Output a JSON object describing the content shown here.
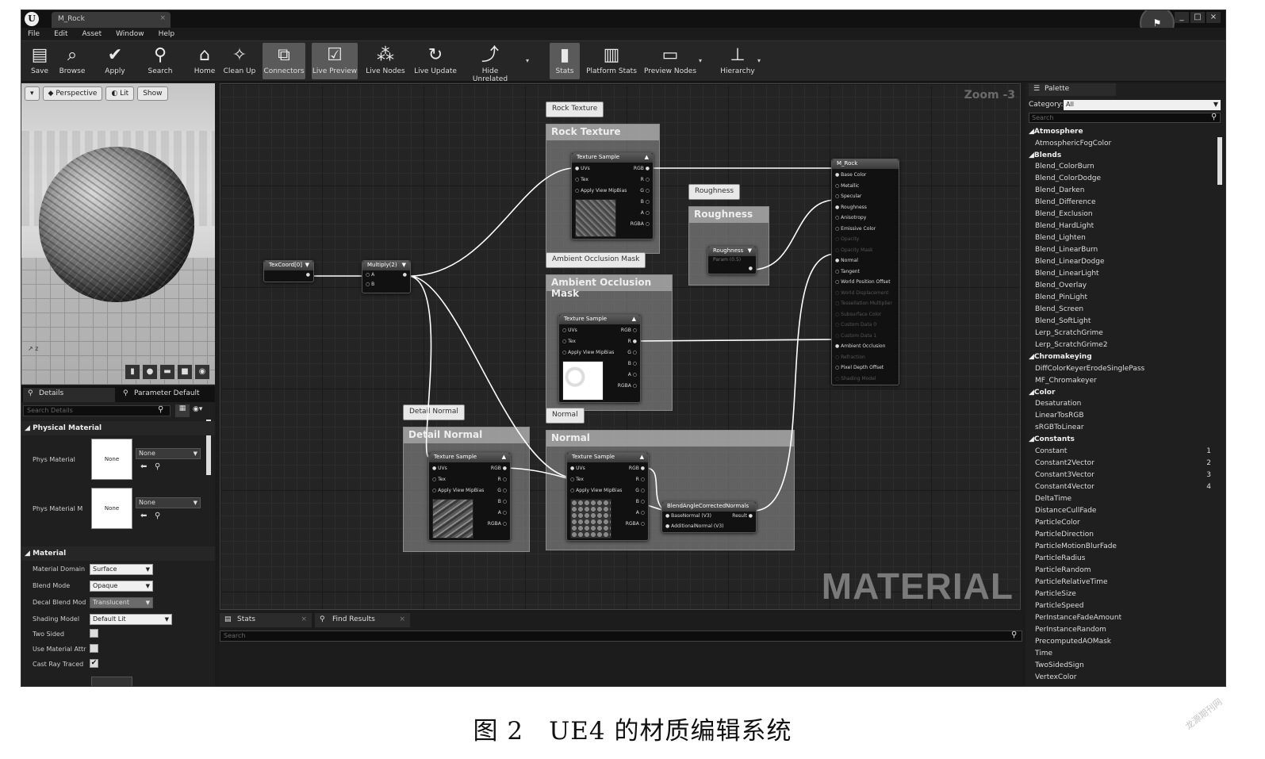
{
  "window": {
    "tab_title": "M_Rock",
    "controls": [
      "_",
      "□",
      "×"
    ],
    "feedback_icon": "flag-icon"
  },
  "menu": [
    "File",
    "Edit",
    "Asset",
    "Window",
    "Help"
  ],
  "toolbar": [
    {
      "label": "Save",
      "icon": "save-icon",
      "glyph": "▤"
    },
    {
      "label": "Browse",
      "icon": "browse-icon",
      "glyph": "⌕"
    },
    {
      "label": "Apply",
      "icon": "apply-icon",
      "glyph": "✔"
    },
    {
      "label": "Search",
      "icon": "search-icon",
      "glyph": "⚲"
    },
    {
      "label": "Home",
      "icon": "home-icon",
      "glyph": "⌂"
    },
    {
      "label": "Clean Up",
      "icon": "cleanup-icon",
      "glyph": "✧"
    },
    {
      "label": "Connectors",
      "icon": "connectors-icon",
      "glyph": "⧉"
    },
    {
      "label": "Live Preview",
      "icon": "live-preview-icon",
      "glyph": "☑"
    },
    {
      "label": "Live Nodes",
      "icon": "live-nodes-icon",
      "glyph": "⁂"
    },
    {
      "label": "Live Update",
      "icon": "live-update-icon",
      "glyph": "↻"
    },
    {
      "label": "Hide Unrelated",
      "icon": "hide-unrelated-icon",
      "glyph": "⤴"
    },
    {
      "label": "Stats",
      "icon": "stats-icon",
      "glyph": "▮"
    },
    {
      "label": "Platform Stats",
      "icon": "platform-stats-icon",
      "glyph": "▥"
    },
    {
      "label": "Preview Nodes",
      "icon": "preview-nodes-icon",
      "glyph": "▭"
    },
    {
      "label": "Hierarchy",
      "icon": "hierarchy-icon",
      "glyph": "⊥"
    }
  ],
  "viewport": {
    "menu_button": "▾",
    "perspective": "Perspective",
    "lit": "Lit",
    "show": "Show",
    "axis": "z",
    "preview_shapes": [
      "cylinder-icon",
      "sphere-icon",
      "plane-icon",
      "cube-icon",
      "teapot-icon"
    ]
  },
  "details": {
    "tab_details": "Details",
    "tab_param": "Parameter Default",
    "search_placeholder": "Search Details",
    "physical_material_header": "Physical Material",
    "phys_material_label": "Phys Material",
    "phys_material_mask_label": "Phys Material M",
    "thumb_text": "None",
    "combo_none": "None",
    "material_header": "Material",
    "rows": [
      {
        "label": "Material Domain",
        "value": "Surface"
      },
      {
        "label": "Blend Mode",
        "value": "Opaque"
      },
      {
        "label": "Decal Blend Mod",
        "value": "Translucent"
      },
      {
        "label": "Shading Model",
        "value": "Default Lit"
      }
    ],
    "two_sided": "Two Sided",
    "use_material": "Use Material Attr",
    "cast_ray": "Cast Ray Traced",
    "two_sided_checked": false,
    "use_material_checked": false,
    "cast_ray_checked": true
  },
  "graph": {
    "zoom": "Zoom -3",
    "watermark": "MATERIAL",
    "comments": {
      "rock": "Rock Texture",
      "roughness": "Roughness",
      "ao": "Ambient Occlusion Mask",
      "detail": "Detail Normal",
      "normal": "Normal"
    },
    "nodes": {
      "texcoord": "TexCoord[0]",
      "multiply": "Multiply(2)",
      "multiply_pins": [
        "A",
        "B"
      ],
      "texture_sample": "Texture Sample",
      "ts_inputs": [
        "UVs",
        "Tex",
        "Apply View MipBias"
      ],
      "ts_outputs": [
        "RGB",
        "R",
        "G",
        "B",
        "A",
        "RGBA"
      ],
      "roughness_param": "Roughness",
      "roughness_param_sub": "Param (0.5)",
      "blend": "BlendAngleCorrectedNormals",
      "blend_inputs": [
        "BaseNormal (V3)",
        "AdditionalNormal (V3)"
      ],
      "blend_output": "Result",
      "result": "M_Rock",
      "result_pins": [
        "Base Color",
        "Metallic",
        "Specular",
        "Roughness",
        "Anisotropy",
        "Emissive Color",
        "Opacity",
        "Opacity Mask",
        "Normal",
        "Tangent",
        "World Position Offset",
        "World Displacement",
        "Tessellation Multiplier",
        "Subsurface Color",
        "Custom Data 0",
        "Custom Data 1",
        "Ambient Occlusion",
        "Refraction",
        "Pixel Depth Offset",
        "Shading Model"
      ]
    }
  },
  "palette": {
    "tab": "Palette",
    "category_label": "Category:",
    "category_value": "All",
    "search_placeholder": "Search",
    "items": [
      {
        "text": "Atmosphere",
        "cat": true
      },
      {
        "text": "AtmosphericFogColor"
      },
      {
        "text": "Blends",
        "cat": true
      },
      {
        "text": "Blend_ColorBurn"
      },
      {
        "text": "Blend_ColorDodge"
      },
      {
        "text": "Blend_Darken"
      },
      {
        "text": "Blend_Difference"
      },
      {
        "text": "Blend_Exclusion"
      },
      {
        "text": "Blend_HardLight"
      },
      {
        "text": "Blend_Lighten"
      },
      {
        "text": "Blend_LinearBurn"
      },
      {
        "text": "Blend_LinearDodge"
      },
      {
        "text": "Blend_LinearLight"
      },
      {
        "text": "Blend_Overlay"
      },
      {
        "text": "Blend_PinLight"
      },
      {
        "text": "Blend_Screen"
      },
      {
        "text": "Blend_SoftLight"
      },
      {
        "text": "Lerp_ScratchGrime"
      },
      {
        "text": "Lerp_ScratchGrime2"
      },
      {
        "text": "Chromakeying",
        "cat": true
      },
      {
        "text": "DiffColorKeyerErodeSinglePass"
      },
      {
        "text": "MF_Chromakeyer"
      },
      {
        "text": "Color",
        "cat": true
      },
      {
        "text": "Desaturation"
      },
      {
        "text": "LinearTosRGB"
      },
      {
        "text": "sRGBToLinear"
      },
      {
        "text": "Constants",
        "cat": true
      },
      {
        "text": "Constant",
        "hotkey": "1"
      },
      {
        "text": "Constant2Vector",
        "hotkey": "2"
      },
      {
        "text": "Constant3Vector",
        "hotkey": "3"
      },
      {
        "text": "Constant4Vector",
        "hotkey": "4"
      },
      {
        "text": "DeltaTime"
      },
      {
        "text": "DistanceCullFade"
      },
      {
        "text": "ParticleColor"
      },
      {
        "text": "ParticleDirection"
      },
      {
        "text": "ParticleMotionBlurFade"
      },
      {
        "text": "ParticleRadius"
      },
      {
        "text": "ParticleRandom"
      },
      {
        "text": "ParticleRelativeTime"
      },
      {
        "text": "ParticleSize"
      },
      {
        "text": "ParticleSpeed"
      },
      {
        "text": "PerInstanceFadeAmount"
      },
      {
        "text": "PerInstanceRandom"
      },
      {
        "text": "PrecomputedAOMask"
      },
      {
        "text": "Time"
      },
      {
        "text": "TwoSidedSign"
      },
      {
        "text": "VertexColor"
      }
    ]
  },
  "bottom": {
    "tab_stats": "Stats",
    "tab_find": "Find Results",
    "search_placeholder": "Search"
  },
  "caption": "图 2　UE4 的材质编辑系统",
  "watermark_stamp": "龙源期刊网"
}
